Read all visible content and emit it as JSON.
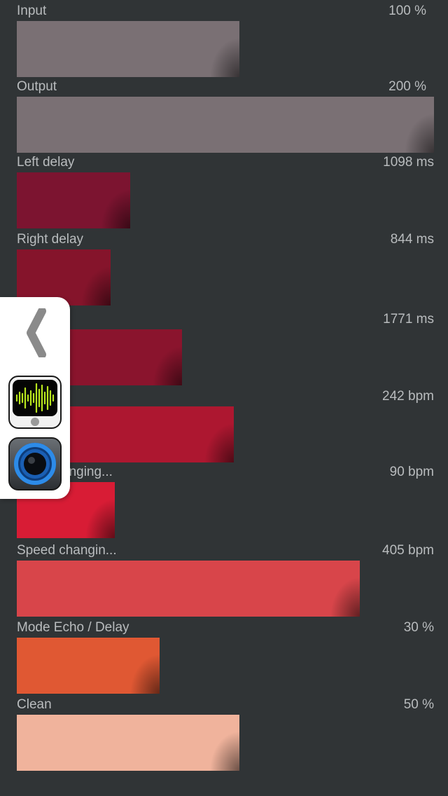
{
  "rows": [
    {
      "label": "Input",
      "value": "100 %",
      "level": 0.534,
      "color": "#7a7074"
    },
    {
      "label": "Output",
      "value": "200 %",
      "level": 1.0,
      "color": "#7a7074"
    },
    {
      "label": "Left delay",
      "value": "1098 ms",
      "level": 0.272,
      "color": "#7c1430"
    },
    {
      "label": "Right delay",
      "value": "844 ms",
      "level": 0.225,
      "color": "#85142b"
    },
    {
      "label": "",
      "value": "1771 ms",
      "level": 0.396,
      "color": "#8a142d"
    },
    {
      "label": "",
      "value": "242 bpm",
      "level": 0.52,
      "color": "#ad1730"
    },
    {
      "label": "anging...",
      "value": "90 bpm",
      "level": 0.235,
      "color": "#d81c35"
    },
    {
      "label": "Speed changin...",
      "value": "405 bpm",
      "level": 0.822,
      "color": "#d8454a"
    },
    {
      "label": "Mode Echo / Delay",
      "value": "30 %",
      "level": 0.342,
      "color": "#e05833"
    },
    {
      "label": "Clean",
      "value": "50 %",
      "level": 0.534,
      "color": "#f0b39c"
    }
  ],
  "side_panel": {
    "collapse_icon": "chevron-left-icon",
    "apps": [
      {
        "name": "audio-waveform-app-icon",
        "accent": "#b8e61e"
      },
      {
        "name": "blue-speaker-app-icon",
        "accent": "#1e73d8"
      }
    ]
  },
  "colors": {
    "background": "#303436",
    "text": "#b9bcbe"
  }
}
